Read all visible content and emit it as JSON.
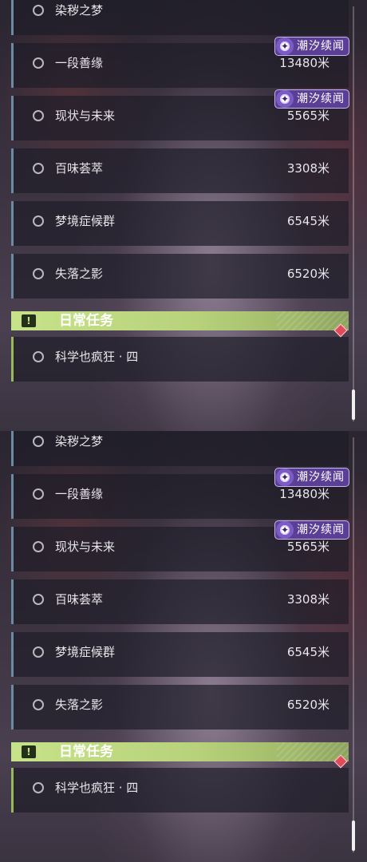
{
  "quest_list": {
    "items": [
      {
        "title": "染秽之梦",
        "distance": ""
      },
      {
        "title": "一段善缘",
        "distance": "13480米",
        "badge": "潮汐续闻"
      },
      {
        "title": "现状与未来",
        "distance": "5565米",
        "badge": "潮汐续闻"
      },
      {
        "title": "百味荟萃",
        "distance": "3308米"
      },
      {
        "title": "梦境症候群",
        "distance": "6545米"
      },
      {
        "title": "失落之影",
        "distance": "6520米"
      }
    ],
    "daily_header": "日常任务",
    "daily_icon": "!",
    "daily_items": [
      {
        "title": "科学也疯狂 · 四"
      }
    ],
    "badge_icon": "✦"
  },
  "colors": {
    "accent_blue": "#6b8aa3",
    "accent_green": "#c7e38a",
    "badge_purple": "#5b3f96",
    "marker_red": "#e04a5a"
  }
}
